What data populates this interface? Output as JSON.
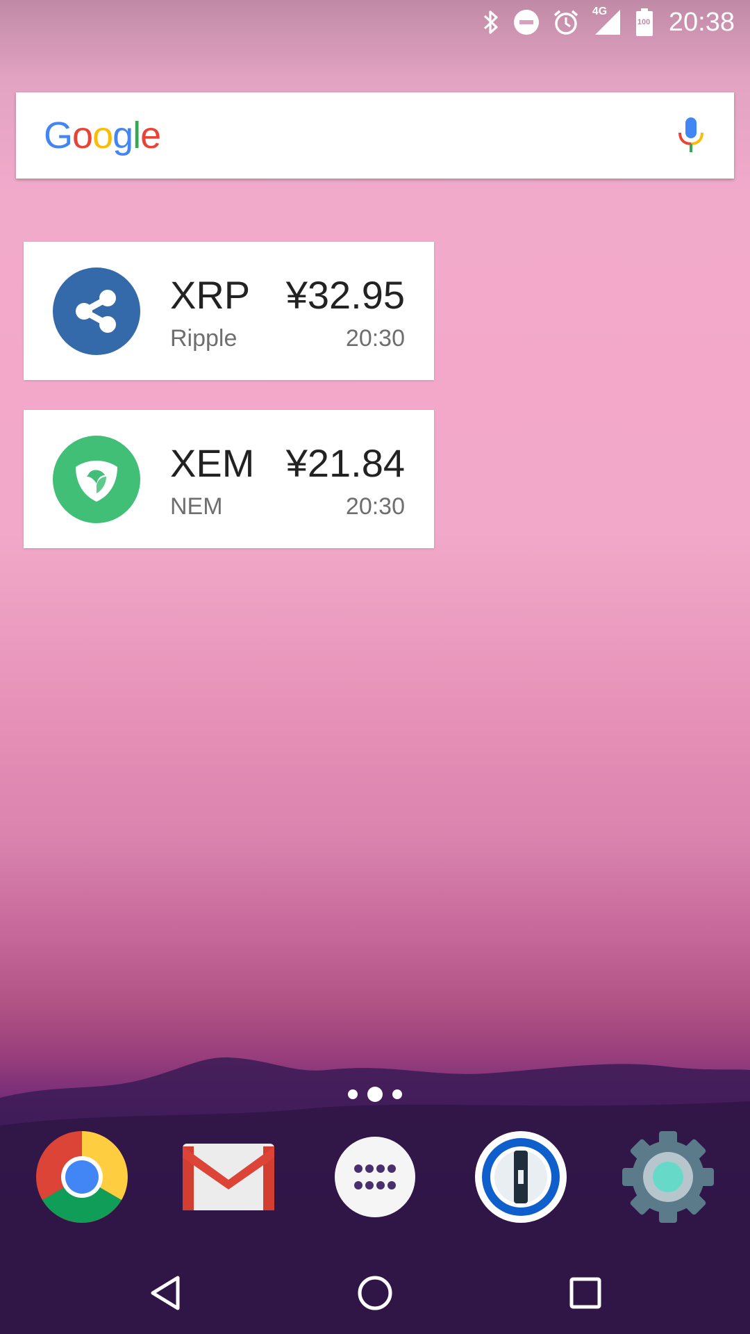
{
  "status_bar": {
    "time": "20:38",
    "network_label": "4G",
    "battery_label": "100",
    "icons": [
      "bluetooth-icon",
      "do-not-disturb-icon",
      "alarm-icon",
      "signal-icon",
      "battery-icon"
    ]
  },
  "search": {
    "logo_letters": [
      "G",
      "o",
      "o",
      "g",
      "l",
      "e"
    ],
    "logo_colors": [
      "#4285F4",
      "#EA4335",
      "#FBBC05",
      "#4285F4",
      "#34A853",
      "#EA4335"
    ],
    "mic_icon": "mic-icon"
  },
  "widgets": [
    {
      "symbol": "XRP",
      "name": "Ripple",
      "price": "¥32.95",
      "time": "20:30",
      "icon": "ripple-logo-icon",
      "color": "#346aa9"
    },
    {
      "symbol": "XEM",
      "name": "NEM",
      "price": "¥21.84",
      "time": "20:30",
      "icon": "nem-logo-icon",
      "color": "#41bf76"
    }
  ],
  "pager": {
    "pages": 3,
    "active_index": 1
  },
  "dock": [
    {
      "name": "Chrome",
      "icon": "chrome-icon"
    },
    {
      "name": "Gmail",
      "icon": "gmail-icon"
    },
    {
      "name": "App drawer",
      "icon": "app-drawer-icon"
    },
    {
      "name": "1Password",
      "icon": "1password-icon"
    },
    {
      "name": "Settings",
      "icon": "settings-icon"
    }
  ],
  "nav_bar": [
    "back-icon",
    "home-icon",
    "recents-icon"
  ]
}
